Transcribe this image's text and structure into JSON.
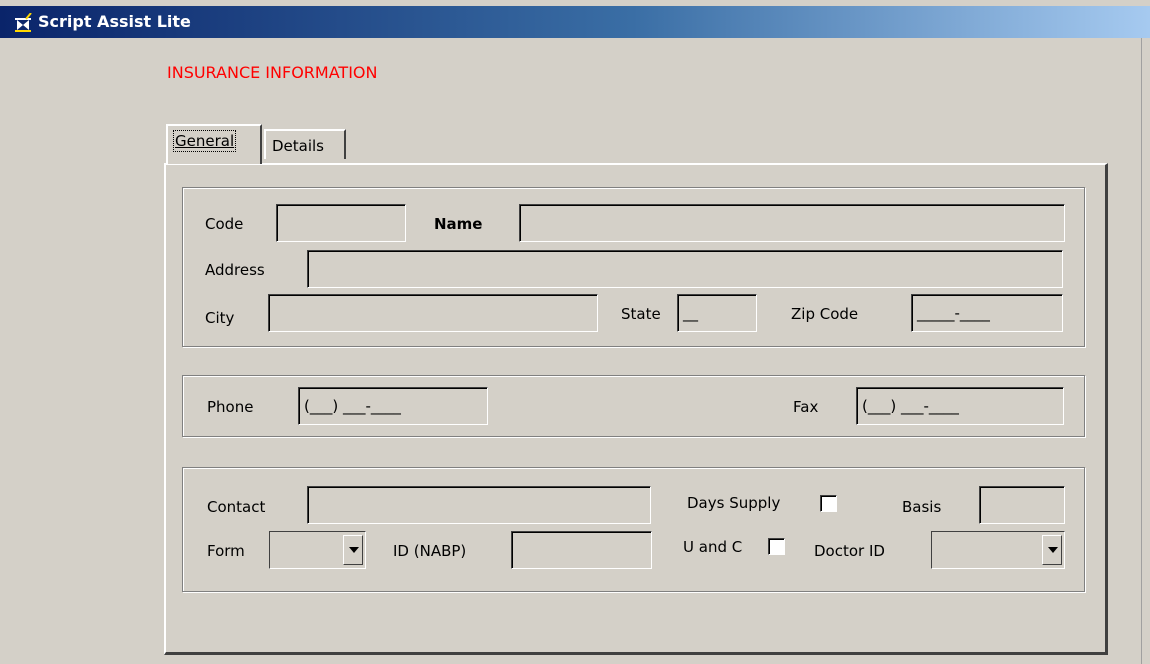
{
  "window": {
    "title": "Script Assist Lite",
    "icon": "mortar-pestle-icon"
  },
  "page_heading": "INSURANCE INFORMATION",
  "tabs": [
    {
      "label": "General",
      "selected": true
    },
    {
      "label": "Details",
      "selected": false
    }
  ],
  "colors": {
    "heading": "#ff0000",
    "titlebar_start": "#0a246a",
    "titlebar_end": "#a6caf0",
    "face": "#d4d0c8"
  },
  "address_group": {
    "code_label": "Code",
    "code_value": "",
    "name_label": "Name",
    "name_value": "",
    "address_label": "Address",
    "address_value": "",
    "city_label": "City",
    "city_value": "",
    "state_label": "State",
    "state_mask": "__",
    "zip_label": "Zip Code",
    "zip_mask": "_____-____"
  },
  "phone_group": {
    "phone_label": "Phone",
    "phone_mask": "(___) ___-____",
    "fax_label": "Fax",
    "fax_mask": "(___) ___-____"
  },
  "misc_group": {
    "contact_label": "Contact",
    "contact_value": "",
    "days_supply_label": "Days Supply",
    "days_supply_checked": false,
    "basis_label": "Basis",
    "basis_value": "",
    "form_label": "Form",
    "form_value": "",
    "id_nabp_label": "ID (NABP)",
    "id_nabp_value": "",
    "u_and_c_label": "U and C",
    "u_and_c_checked": false,
    "doctor_id_label": "Doctor ID",
    "doctor_id_value": ""
  }
}
